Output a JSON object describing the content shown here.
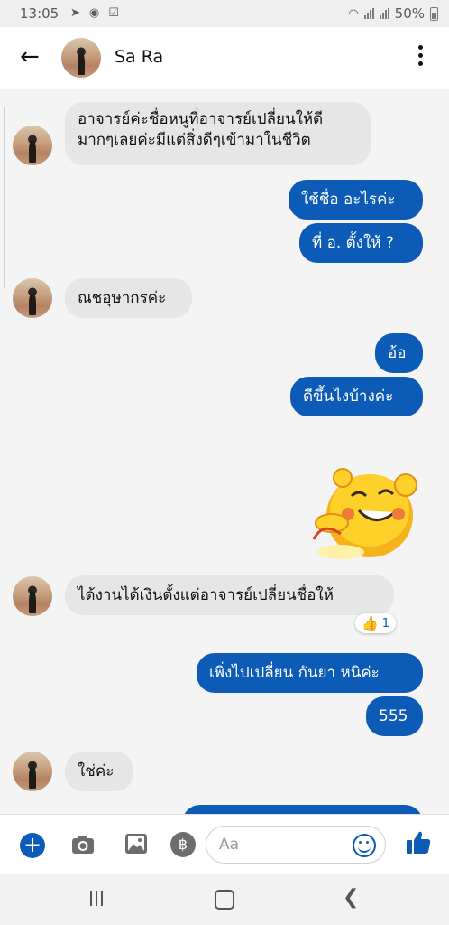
{
  "status_bar": {
    "time": "13:05",
    "battery": "50%"
  },
  "header": {
    "contact_name": "Sa Ra"
  },
  "messages": {
    "m1_line1": "อาจารย์ค่ะชื่อหนูที่อาจารย์เปลี่ยนให้ดี",
    "m1_line2": "มากๆเลยค่ะมีแต่สิ่งดีๆเข้ามาในชีวิต",
    "m2": "ใช้ชื่อ อะไรค่ะ",
    "m3": "ที่ อ. ตั้งให้ ?",
    "m4": "ณชอุษากรค่ะ",
    "m5": "อ้อ",
    "m6": "ดีขึ้นไงบ้างค่ะ",
    "m7": "ได้งานได้เงินตั้งแต่อาจารย์เปลี่ยนชื่อให้",
    "m7_reaction_count": "1",
    "m8": "เพิ่งไปเปลี่ยน กันยา หนิค่ะ",
    "m9": "555",
    "m10": "ใช่ค่ะ"
  },
  "composer": {
    "placeholder": "Aa"
  },
  "colors": {
    "outgoing_bubble": "#0b5bb7",
    "incoming_bubble": "#e6e6e6",
    "accent": "#0b5bb7"
  },
  "icons": [
    "back-arrow-icon",
    "more-options-icon",
    "plus-icon",
    "camera-icon",
    "gallery-icon",
    "baht-icon",
    "emoji-icon",
    "thumbs-up-icon",
    "thumbs-up-reaction-icon",
    "recent-apps-icon",
    "home-icon",
    "nav-back-icon"
  ]
}
